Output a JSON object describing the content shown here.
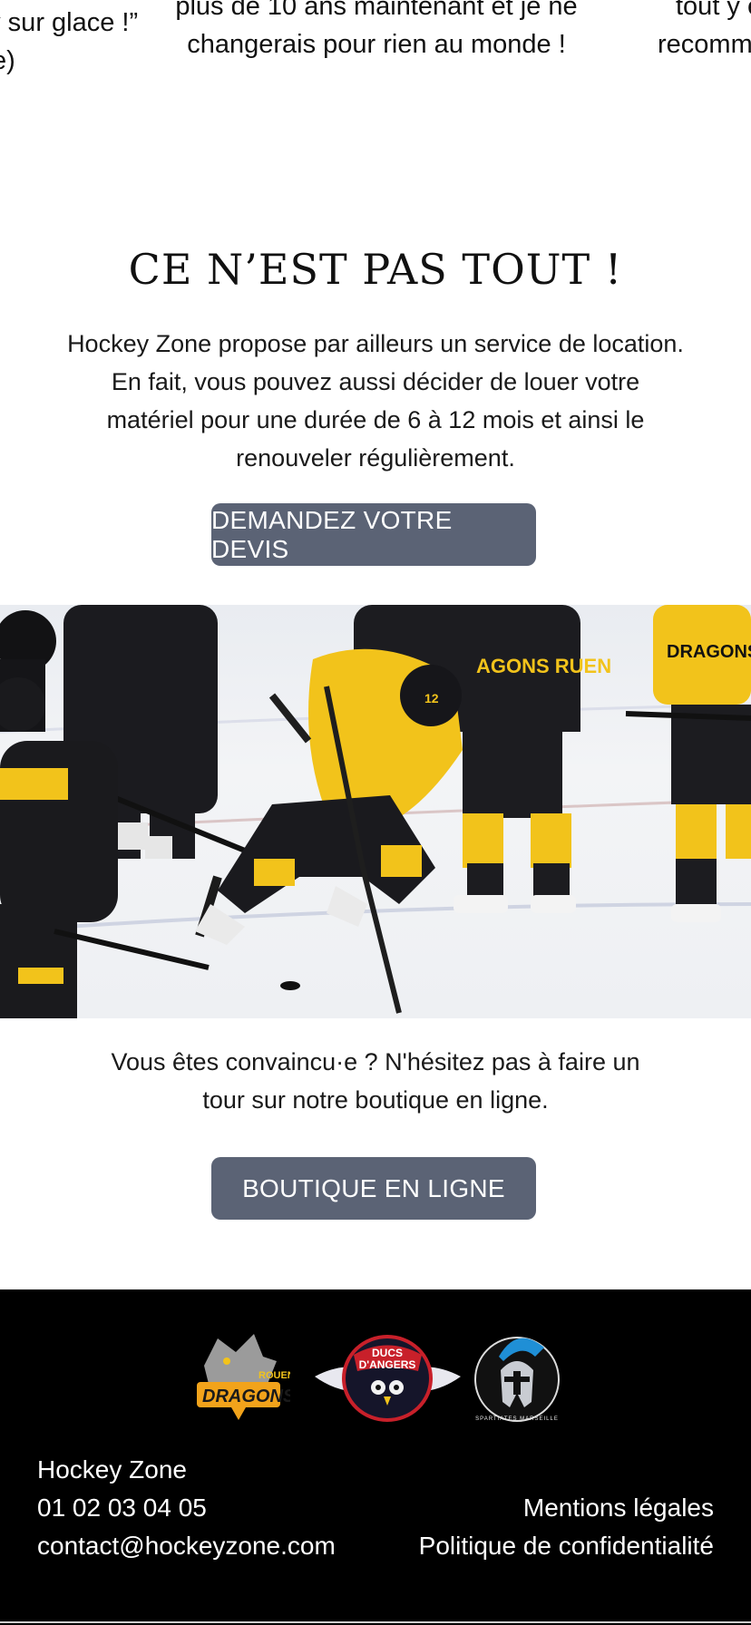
{
  "testimonials": {
    "left_line1": "ey sur glace !”",
    "left_line2": "cle)",
    "middle_line1": "plus de 10 ans maintenant et je ne",
    "middle_line2": "changerais pour rien au monde !",
    "right_line1": "tout y e",
    "right_line2": "recomma"
  },
  "rental": {
    "title": "CE N’EST PAS TOUT !",
    "description": "Hockey Zone propose par ailleurs un service de location. En fait, vous pouvez aussi décider de louer votre matériel pour une durée de 6 à 12 mois et ainsi le renouveler régulièrement.",
    "cta_label": "DEMANDEZ VOTRE DEVIS"
  },
  "photo": {
    "jersey_text_1": "DRAGONS ROUEN",
    "jersey_text_2": "AGONS RUEN",
    "jersey_number": "12"
  },
  "shop": {
    "description": "Vous êtes convaincu·e ? N'hésitez pas à faire un tour sur notre boutique en ligne.",
    "cta_label": "BOUTIQUE EN LIGNE"
  },
  "footer": {
    "logos": {
      "dragons_top": "ROUEN",
      "dragons_main": "DRAGONS",
      "ducs_line1": "DUCS",
      "ducs_line2": "D'ANGERS",
      "spartiates": "SPARTIATES MARSEILLE"
    },
    "company": "Hockey Zone",
    "phone": "01 02 03 04 05",
    "email": "contact@hockeyzone.com",
    "legal_link": "Mentions légales",
    "privacy_link": "Politique de confidentialité"
  },
  "colors": {
    "button_bg": "#5b6375",
    "footer_bg": "#000000",
    "jersey_yellow": "#f2c31b"
  }
}
